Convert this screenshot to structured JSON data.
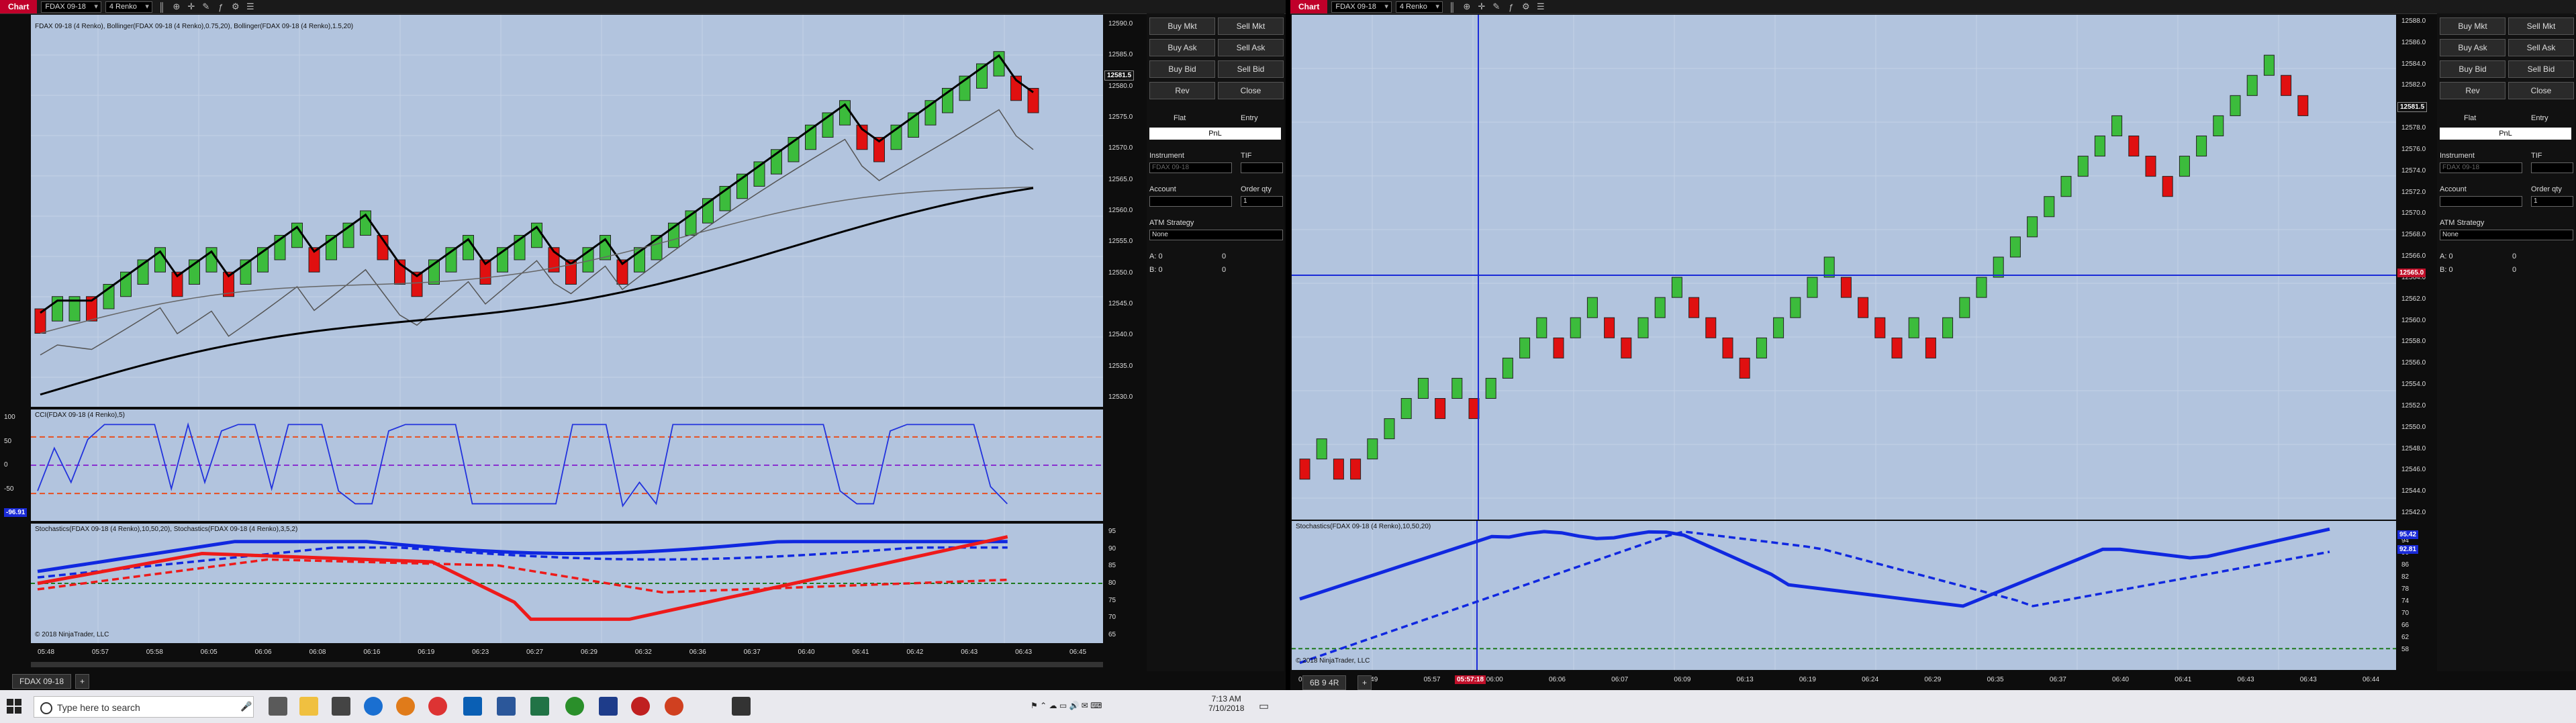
{
  "left_window": {
    "title_label": "Chart",
    "instrument": "FDAX 09-18",
    "bar_type": "4 Renko",
    "price_panel_label": "FDAX 09-18 (4 Renko), Bollinger(FDAX 09-18 (4 Renko),0.75,20), Bollinger(FDAX 09-18 (4 Renko),1.5,20)",
    "cci_label": "CCI(FDAX 09-18 (4 Renko),5)",
    "stoch_label": "Stochastics(FDAX 09-18 (4 Renko),10,50,20), Stochastics(FDAX 09-18 (4 Renko),3,5,2)",
    "copyright": "© 2018 NinjaTrader, LLC",
    "price_ticks": [
      "12590.0",
      "12585.0",
      "12580.0",
      "12575.0",
      "12570.0",
      "12565.0",
      "12560.0",
      "12555.0",
      "12550.0",
      "12545.0",
      "12540.0",
      "12535.0",
      "12530.0"
    ],
    "current_price": "12581.5",
    "cci_ticks": [
      "100",
      "50",
      "0",
      "-50",
      "-100"
    ],
    "cci_value": "-96.91",
    "stoch_ticks": [
      "95",
      "90",
      "85",
      "80",
      "75",
      "70",
      "65"
    ],
    "time_ticks": [
      "05:48",
      "05:57",
      "05:58",
      "06:05",
      "06:06",
      "06:08",
      "06:16",
      "06:19",
      "06:23",
      "06:27",
      "06:29",
      "06:32",
      "06:36",
      "06:37",
      "06:40",
      "06:41",
      "06:42",
      "06:43",
      "06:43",
      "06:45"
    ],
    "tab_label": "FDAX 09-18"
  },
  "right_window": {
    "title_label": "Chart",
    "instrument": "FDAX 09-18",
    "bar_type": "4 Renko",
    "stoch_label": "Stochastics(FDAX 09-18 (4 Renko),10,50,20)",
    "copyright": "© 2018 NinjaTrader, LLC",
    "price_ticks": [
      "12588.0",
      "12586.0",
      "12584.0",
      "12582.0",
      "12580.0",
      "12578.0",
      "12576.0",
      "12574.0",
      "12572.0",
      "12570.0",
      "12568.0",
      "12566.0",
      "12564.0",
      "12562.0",
      "12560.0",
      "12558.0",
      "12556.0",
      "12554.0",
      "12552.0",
      "12550.0",
      "12548.0",
      "12546.0",
      "12544.0",
      "12542.0"
    ],
    "current_price": "12581.5",
    "crosshair_price": "12565.0",
    "stoch_ticks": [
      "94",
      "90",
      "86",
      "82",
      "78",
      "74",
      "70",
      "66",
      "62",
      "58"
    ],
    "stoch_values": [
      "95.42",
      "92.81"
    ],
    "time_ticks": [
      "05:45",
      "05:49",
      "05:57",
      "06:00",
      "06:06",
      "06:07",
      "06:09",
      "06:13",
      "06:19",
      "06:24",
      "06:29",
      "06:35",
      "06:37",
      "06:40",
      "06:41",
      "06:43",
      "06:43",
      "06:44"
    ],
    "crosshair_time": "05:57:18",
    "tab_label": "6B 9 4R"
  },
  "order_panel": {
    "buttons": [
      [
        "Buy Mkt",
        "Sell Mkt"
      ],
      [
        "Buy Ask",
        "Sell Ask"
      ],
      [
        "Buy Bid",
        "Sell Bid"
      ],
      [
        "Rev",
        "Close"
      ]
    ],
    "flat_label": "Flat",
    "entry_label": "Entry",
    "pnl_label": "PnL",
    "instrument_label": "Instrument",
    "tif_label": "TIF",
    "instrument_value": "FDAX 09-18",
    "account_label": "Account",
    "order_qty_label": "Order qty",
    "order_qty_value": "1",
    "atm_label": "ATM Strategy",
    "atm_value": "None",
    "a_label": "A:",
    "b_label": "B:",
    "a_values": [
      "0",
      "0"
    ],
    "b_values": [
      "0",
      "0"
    ]
  },
  "taskbar": {
    "search_placeholder": "Type here to search",
    "time": "7:13 AM",
    "date": "7/10/2018"
  },
  "colors": {
    "plot_bg": "#b2c4de",
    "up_brick": "#3cbc3c",
    "down_brick": "#e01010",
    "cci_line": "#2233dd",
    "stoch_blue": "#1028e0",
    "stoch_red": "#ee1a1a",
    "crosshair": "#1a2bd8"
  }
}
